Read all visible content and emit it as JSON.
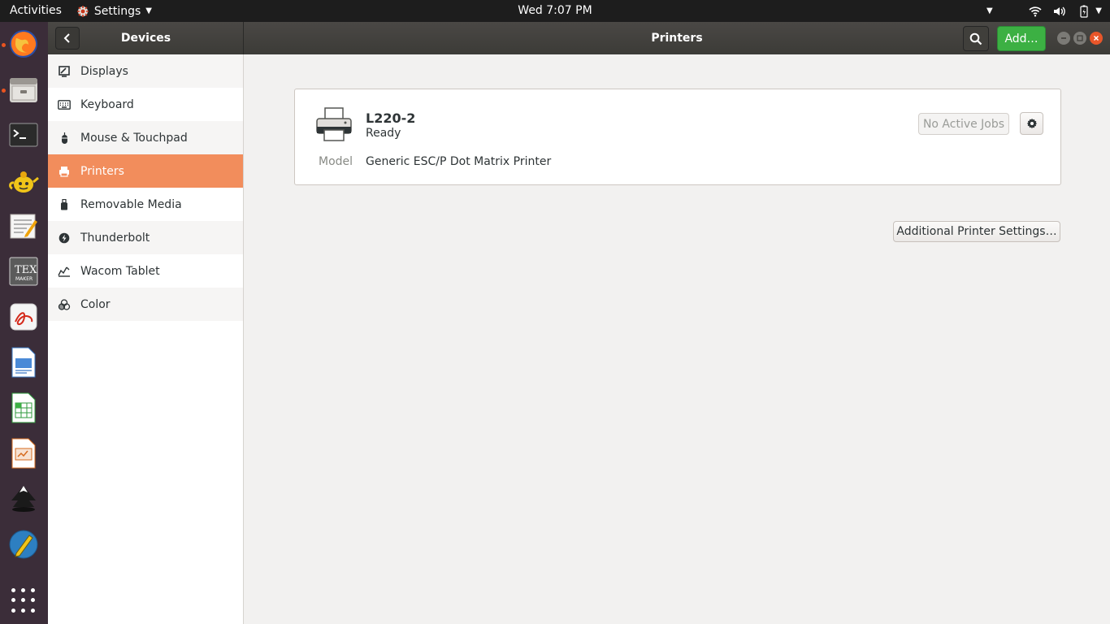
{
  "topbar": {
    "activities": "Activities",
    "app_name": "Settings",
    "clock": "Wed  7:07 PM",
    "icons": [
      "keyboard-layout-caret",
      "wifi-icon",
      "volume-icon",
      "battery-icon",
      "system-menu-caret"
    ]
  },
  "dock": {
    "apps": [
      "firefox",
      "files",
      "terminal",
      "teapot",
      "text-editor",
      "texmaker",
      "pdf-viewer",
      "writer",
      "calc",
      "impress",
      "inkscape",
      "scribus"
    ],
    "show_apps": "show-applications"
  },
  "header": {
    "left_title": "Devices",
    "main_title": "Printers",
    "add_label": "Add…",
    "accent": "#3cb043"
  },
  "sidebar": {
    "items": [
      {
        "label": "Displays",
        "icon": "display-icon"
      },
      {
        "label": "Keyboard",
        "icon": "keyboard-icon"
      },
      {
        "label": "Mouse & Touchpad",
        "icon": "mouse-icon"
      },
      {
        "label": "Printers",
        "icon": "printer-icon",
        "active": true
      },
      {
        "label": "Removable Media",
        "icon": "usb-icon"
      },
      {
        "label": "Thunderbolt",
        "icon": "thunderbolt-icon"
      },
      {
        "label": "Wacom Tablet",
        "icon": "tablet-icon"
      },
      {
        "label": "Color",
        "icon": "color-icon"
      }
    ],
    "active_color": "#f28d5c"
  },
  "printer": {
    "name": "L220-2",
    "status": "Ready",
    "model_label": "Model",
    "model_value": "Generic ESC/P Dot Matrix Printer",
    "jobs_label": "No Active Jobs"
  },
  "main": {
    "additional_label": "Additional Printer Settings…"
  }
}
